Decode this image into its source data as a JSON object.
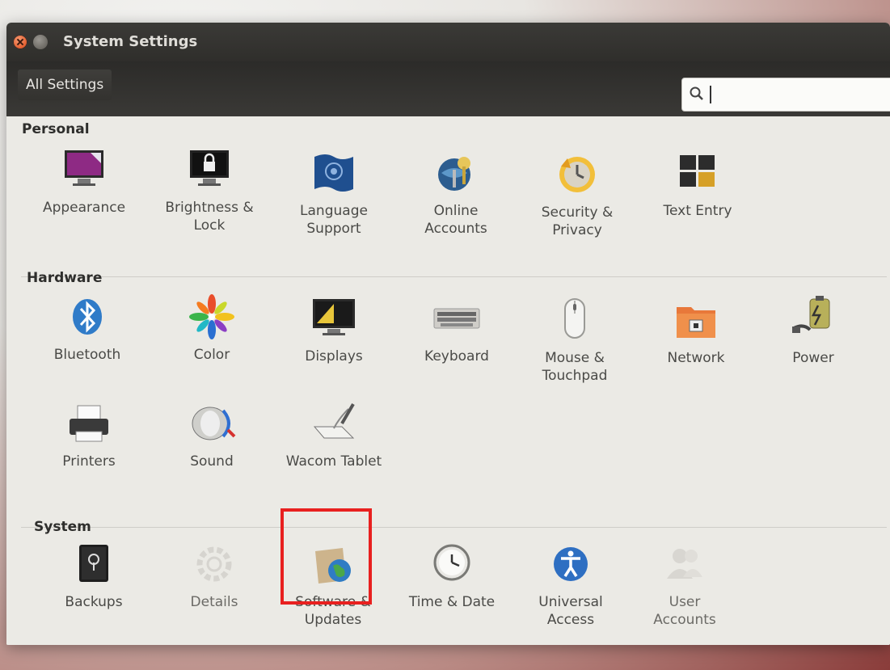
{
  "window": {
    "title": "System Settings"
  },
  "toolbar": {
    "all_settings_label": "All Settings",
    "search_value": "",
    "search_placeholder": ""
  },
  "sections": {
    "personal": {
      "title": "Personal",
      "items": [
        {
          "label": "Appearance",
          "icon": "appearance-icon"
        },
        {
          "label": "Brightness &\nLock",
          "icon": "brightness-lock-icon"
        },
        {
          "label": "Language\nSupport",
          "icon": "language-support-icon"
        },
        {
          "label": "Online\nAccounts",
          "icon": "online-accounts-icon"
        },
        {
          "label": "Security &\nPrivacy",
          "icon": "security-privacy-icon"
        },
        {
          "label": "Text Entry",
          "icon": "text-entry-icon"
        }
      ]
    },
    "hardware": {
      "title": "Hardware",
      "items": [
        {
          "label": "Bluetooth",
          "icon": "bluetooth-icon"
        },
        {
          "label": "Color",
          "icon": "color-icon"
        },
        {
          "label": "Displays",
          "icon": "displays-icon"
        },
        {
          "label": "Keyboard",
          "icon": "keyboard-icon"
        },
        {
          "label": "Mouse &\nTouchpad",
          "icon": "mouse-icon"
        },
        {
          "label": "Network",
          "icon": "network-icon"
        },
        {
          "label": "Power",
          "icon": "power-icon"
        },
        {
          "label": "Printers",
          "icon": "printer-icon"
        },
        {
          "label": "Sound",
          "icon": "sound-icon"
        },
        {
          "label": "Wacom Tablet",
          "icon": "wacom-tablet-icon"
        }
      ]
    },
    "system": {
      "title": "System",
      "items": [
        {
          "label": "Backups",
          "icon": "backups-icon"
        },
        {
          "label": "Details",
          "icon": "details-icon"
        },
        {
          "label": "Software &\nUpdates",
          "icon": "software-updates-icon"
        },
        {
          "label": "Time & Date",
          "icon": "clock-icon"
        },
        {
          "label": "Universal\nAccess",
          "icon": "universal-access-icon"
        },
        {
          "label": "User\nAccounts",
          "icon": "user-accounts-icon"
        }
      ]
    }
  },
  "colors": {
    "highlight_box": "#e8201f",
    "titlebar": "#3b3a37",
    "content_bg": "#ebeae5"
  }
}
